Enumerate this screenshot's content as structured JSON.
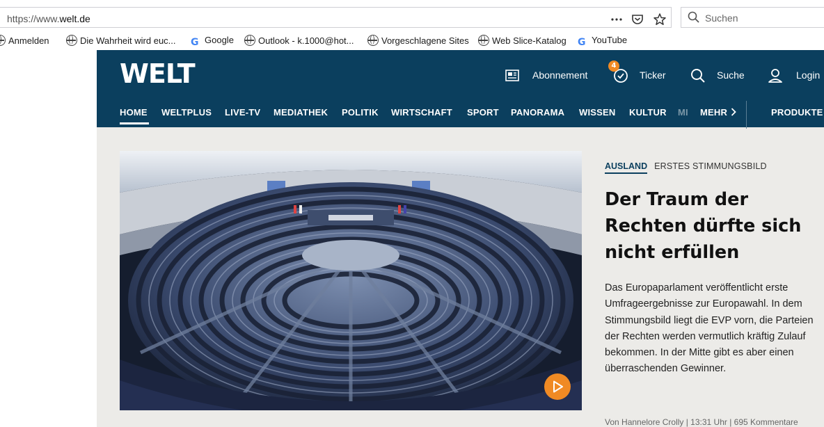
{
  "browser": {
    "url_prefix": "https://www.",
    "url_host": "welt.de",
    "search_placeholder": "Suchen",
    "more_icon": "ellipsis-icon",
    "pocket_icon": "pocket-icon",
    "bookmark_icon": "star-icon"
  },
  "bookmarks": {
    "items": [
      {
        "label": "Anmelden",
        "icon": "globe-icon"
      },
      {
        "label": "Die Wahrheit wird euc...",
        "icon": "globe-icon"
      },
      {
        "label": "Google",
        "icon": "google-icon"
      },
      {
        "label": "Outlook - k.1000@hot...",
        "icon": "globe-icon"
      },
      {
        "label": "Vorgeschlagene Sites",
        "icon": "globe-icon"
      },
      {
        "label": "Web Slice-Katalog",
        "icon": "globe-icon"
      },
      {
        "label": "YouTube",
        "icon": "google-icon"
      }
    ]
  },
  "site": {
    "logo": "WELT",
    "header": {
      "abo_label": "Abonnement",
      "ticker_label": "Ticker",
      "ticker_badge": "4",
      "search_label": "Suche",
      "login_label": "Login"
    },
    "nav": {
      "items": [
        "HOME",
        "WELTPLUS",
        "LIVE-TV",
        "MEDIATHEK",
        "POLITIK",
        "WIRTSCHAFT",
        "SPORT",
        "PANORAMA",
        "WISSEN",
        "KULTUR",
        "MI",
        "MEHR",
        "PRODUKTE"
      ]
    },
    "article": {
      "section": "AUSLAND",
      "topic": "ERSTES STIMMUNGSBILD",
      "headline": "Der Traum der Rechten dürfte sich nicht erfüllen",
      "teaser": "Das Europaparlament veröffentlicht erste Umfrageergebnisse zur Europawahl. In dem Stimmungsbild liegt die EVP vorn, die Parteien der Rechten werden vermutlich kräftig Zulauf bekommen. In der Mitte gibt es aber einen überraschenden Gewinner.",
      "byline": "Von Hannelore Crolly | 13:31 Uhr | 695 Kommentare",
      "image_subject": "european-parliament-plenary-hall",
      "play_icon": "play-icon"
    },
    "colors": {
      "header_bg": "#0b3f5e",
      "accent_orange": "#f08a24",
      "page_bg": "#ecebe8"
    }
  }
}
